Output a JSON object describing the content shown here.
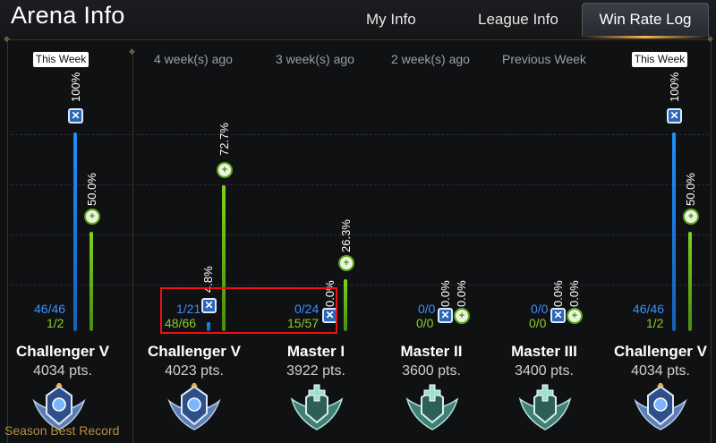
{
  "header": {
    "title": "Arena Info",
    "tabs": [
      {
        "label": "My Info",
        "active": false
      },
      {
        "label": "League Info",
        "active": false
      },
      {
        "label": "Win Rate Log",
        "active": true
      }
    ]
  },
  "colors": {
    "blue_bar": "#1e8ffb",
    "green_bar": "#7fd21b",
    "highlight": "#ee1111",
    "season_gold": "#b98d3a"
  },
  "season_best": {
    "label": "Season Best Record",
    "badge": "This Week",
    "win_rate_1": "100%",
    "win_rate_2": "50.0%",
    "ratio_1": "46/46",
    "ratio_2": "1/2",
    "rank": "Challenger V",
    "points": "4034 pts.",
    "emblem": "challenger-emblem-icon"
  },
  "columns": [
    {
      "header": "4 week(s) ago",
      "win_rate_1": "4.8%",
      "win_rate_2": "72.7%",
      "ratio_1": "1/21",
      "ratio_2": "48/66",
      "rank": "Challenger V",
      "points": "4023 pts.",
      "emblem": "challenger-emblem-icon"
    },
    {
      "header": "3 week(s) ago",
      "win_rate_1": "0.0%",
      "win_rate_2": "26.3%",
      "ratio_1": "0/24",
      "ratio_2": "15/57",
      "rank": "Master I",
      "points": "3922 pts.",
      "emblem": "master-emblem-icon"
    },
    {
      "header": "2 week(s) ago",
      "win_rate_1": "0.0%",
      "win_rate_2": "0.0%",
      "ratio_1": "0/0",
      "ratio_2": "0/0",
      "rank": "Master II",
      "points": "3600 pts.",
      "emblem": "master-emblem-icon"
    },
    {
      "header": "Previous Week",
      "win_rate_1": "0.0%",
      "win_rate_2": "0.0%",
      "ratio_1": "0/0",
      "ratio_2": "0/0",
      "rank": "Master III",
      "points": "3400 pts.",
      "emblem": "master-emblem-icon"
    },
    {
      "header": "This Week",
      "win_rate_1": "100%",
      "win_rate_2": "50.0%",
      "ratio_1": "46/46",
      "ratio_2": "1/2",
      "rank": "Challenger V",
      "points": "4034 pts.",
      "emblem": "challenger-emblem-icon"
    }
  ]
}
